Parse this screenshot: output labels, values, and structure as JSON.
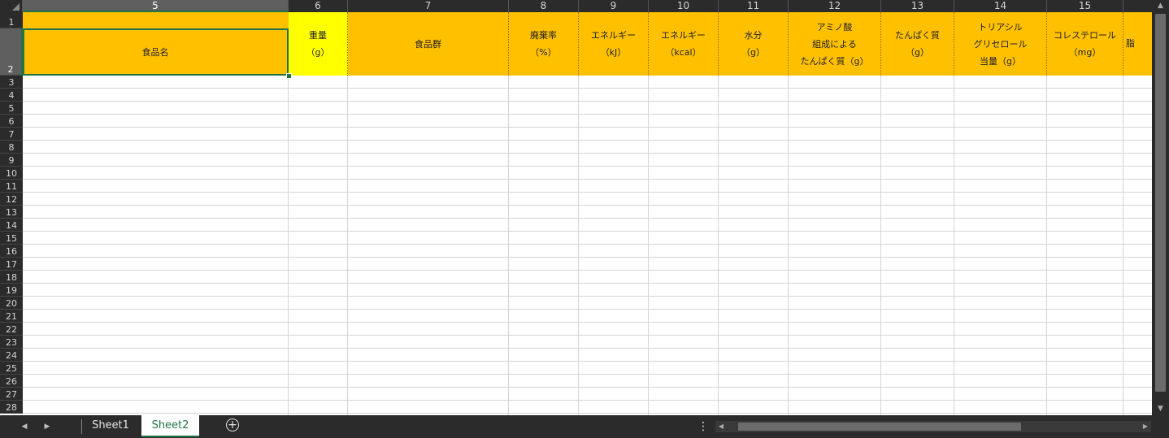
{
  "columns": [
    {
      "label": "5",
      "header": "食品名"
    },
    {
      "label": "6",
      "header": "重量\n（g）"
    },
    {
      "label": "7",
      "header": "食品群"
    },
    {
      "label": "8",
      "header": "廃棄率\n（%）"
    },
    {
      "label": "9",
      "header": "エネルギー\n（kJ）"
    },
    {
      "label": "10",
      "header": "エネルギー\n（kcal）"
    },
    {
      "label": "11",
      "header": "水分\n（g）"
    },
    {
      "label": "12",
      "header": "アミノ酸\n組成による\nたんぱく質（g）"
    },
    {
      "label": "13",
      "header": "たんぱく質\n（g）"
    },
    {
      "label": "14",
      "header": "トリアシル\nグリセロール\n当量（g）"
    },
    {
      "label": "15",
      "header": "コレステロール\n（mg）"
    }
  ],
  "cutoff_column_text": "脂",
  "rows": [
    "1",
    "2",
    "3",
    "4",
    "5",
    "6",
    "7",
    "8",
    "9",
    "10",
    "11",
    "12",
    "13",
    "14",
    "15",
    "16",
    "17",
    "18",
    "19",
    "20",
    "21",
    "22",
    "23",
    "24",
    "25",
    "26",
    "27",
    "28"
  ],
  "sheets": [
    {
      "label": "Sheet1",
      "active": false
    },
    {
      "label": "Sheet2",
      "active": true
    }
  ],
  "colors": {
    "header_orange": "#ffc000",
    "header_yellow": "#ffff00",
    "selection_green": "#217346"
  },
  "icons": {
    "scroll_left": "◀",
    "scroll_right": "▶",
    "add_sheet": "+",
    "more": "⋮"
  }
}
